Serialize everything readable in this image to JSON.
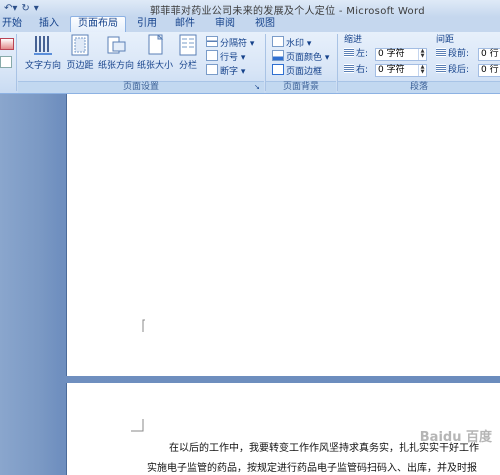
{
  "title": "郭菲菲对药业公司未来的发展及个人定位 - Microsoft Word",
  "tabs": [
    {
      "label": "开始"
    },
    {
      "label": "插入"
    },
    {
      "label": "页面布局"
    },
    {
      "label": "引用"
    },
    {
      "label": "邮件"
    },
    {
      "label": "审阅"
    },
    {
      "label": "视图"
    }
  ],
  "active_tab": "页面布局",
  "ribbon": {
    "page_setup": {
      "label": "页面设置",
      "text_direction": "文字方向",
      "margins": "页边距",
      "orientation": "纸张方向",
      "size": "纸张大小",
      "columns": "分栏",
      "breaks": "分隔符",
      "line_numbers": "行号",
      "hyphenation": "断字"
    },
    "page_background": {
      "label": "页面背景",
      "watermark": "水印",
      "page_color": "页面颜色",
      "page_borders": "页面边框"
    },
    "paragraph": {
      "label": "段落",
      "indent": "缩进",
      "spacing": "间距",
      "left": "左:",
      "right": "右:",
      "before": "段前:",
      "after": "段后:",
      "left_value": "0 字符",
      "right_value": "0 字符",
      "before_value": "0 行",
      "after_value": "0 行"
    }
  },
  "document": {
    "line1": "在以后的工作中，我要转变工作作风坚持求真务实，扎扎实实干好工作",
    "line2": "实施电子监管的药品，按规定进行药品电子监管码扫码入、出库，并及时报"
  },
  "watermark_text": "Baidu 百度"
}
